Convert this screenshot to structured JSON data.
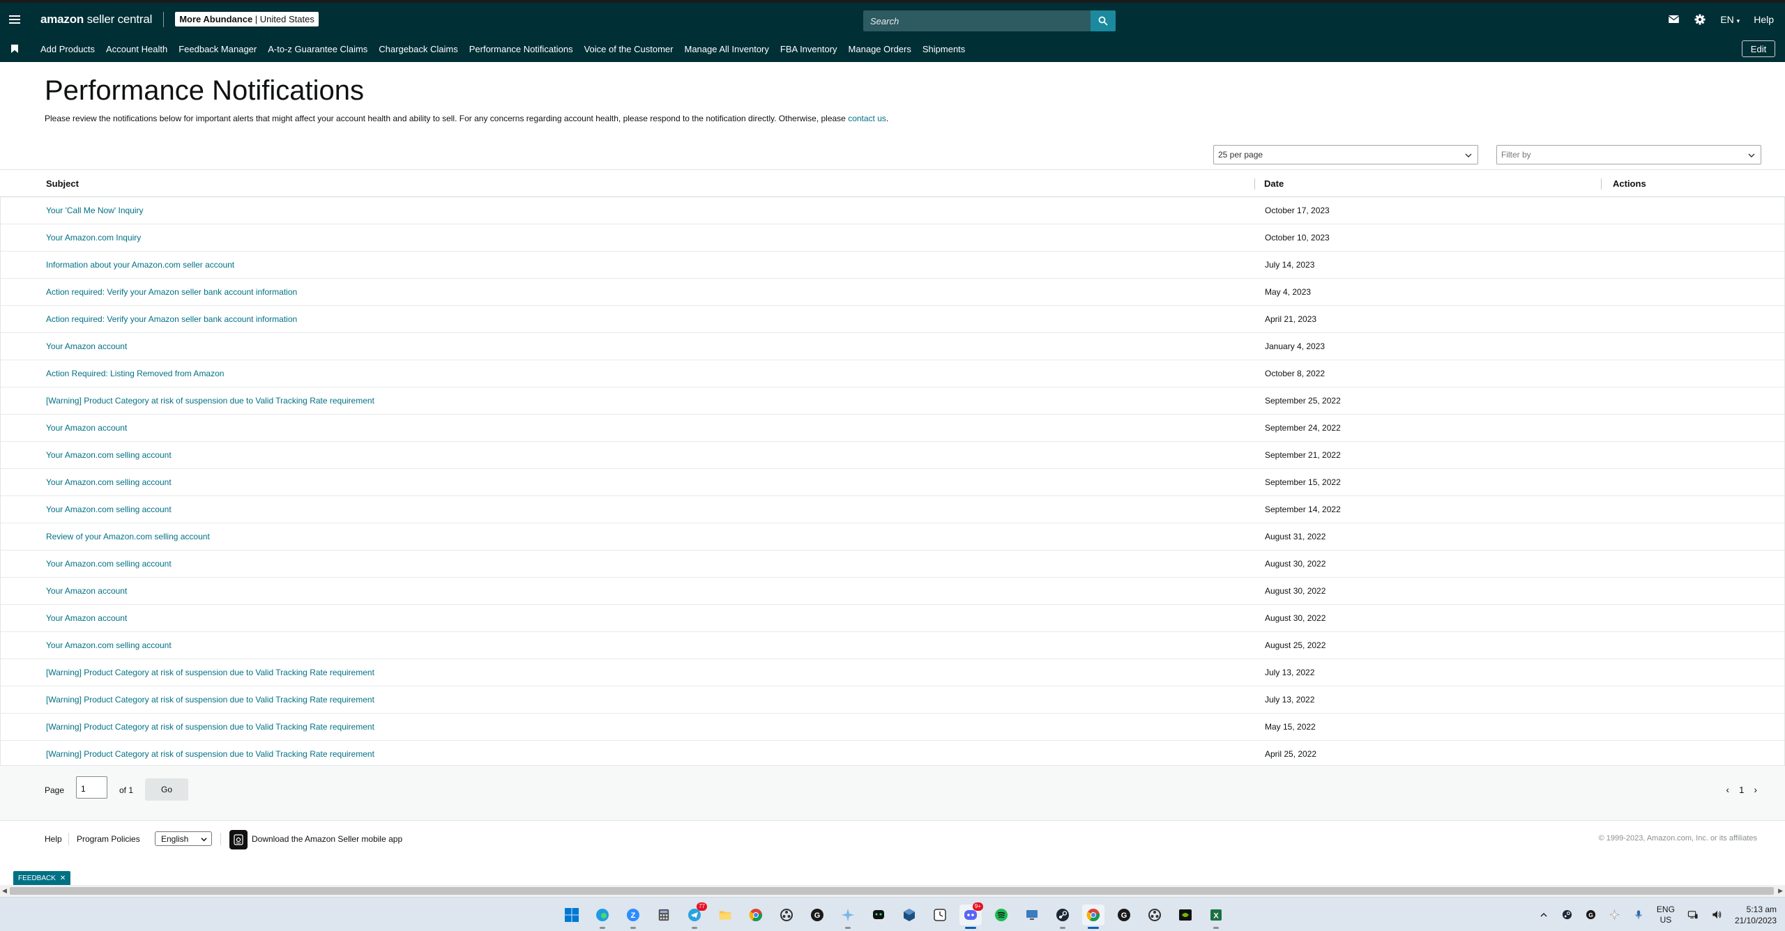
{
  "header": {
    "logo_main": "amazon",
    "logo_sub": "seller central",
    "store_name": "More Abundance",
    "store_marketplace": "United States",
    "search_placeholder": "Search",
    "language": "EN",
    "help": "Help"
  },
  "nav": {
    "items": [
      "Add Products",
      "Account Health",
      "Feedback Manager",
      "A-to-z Guarantee Claims",
      "Chargeback Claims",
      "Performance Notifications",
      "Voice of the Customer",
      "Manage All Inventory",
      "FBA Inventory",
      "Manage Orders",
      "Shipments"
    ],
    "edit_label": "Edit"
  },
  "page": {
    "title": "Performance Notifications",
    "description": "Please review the notifications below for important alerts that might affect your account health and ability to sell. For any concerns regarding account health, please respond to the notification directly. Otherwise, please ",
    "contact_link": "contact us",
    "description_end": "."
  },
  "controls": {
    "per_page": "25 per page",
    "filter_placeholder": "Filter by"
  },
  "table": {
    "headers": {
      "subject": "Subject",
      "date": "Date",
      "actions": "Actions"
    },
    "rows": [
      {
        "subject": "Your 'Call Me Now' Inquiry",
        "date": "October 17, 2023"
      },
      {
        "subject": "Your Amazon.com Inquiry",
        "date": "October 10, 2023"
      },
      {
        "subject": "Information about your Amazon.com seller account",
        "date": "July 14, 2023"
      },
      {
        "subject": "Action required: Verify your Amazon seller bank account information",
        "date": "May 4, 2023"
      },
      {
        "subject": "Action required: Verify your Amazon seller bank account information",
        "date": "April 21, 2023"
      },
      {
        "subject": "Your Amazon account",
        "date": "January 4, 2023"
      },
      {
        "subject": "Action Required: Listing Removed from Amazon",
        "date": "October 8, 2022"
      },
      {
        "subject": "[Warning] Product Category at risk of suspension due to Valid Tracking Rate requirement",
        "date": "September 25, 2022"
      },
      {
        "subject": "Your Amazon account",
        "date": "September 24, 2022"
      },
      {
        "subject": "Your Amazon.com selling account",
        "date": "September 21, 2022"
      },
      {
        "subject": "Your Amazon.com selling account",
        "date": "September 15, 2022"
      },
      {
        "subject": "Your Amazon.com selling account",
        "date": "September 14, 2022"
      },
      {
        "subject": "Review of your Amazon.com selling account",
        "date": "August 31, 2022"
      },
      {
        "subject": "Your Amazon.com selling account",
        "date": "August 30, 2022"
      },
      {
        "subject": "Your Amazon account",
        "date": "August 30, 2022"
      },
      {
        "subject": "Your Amazon account",
        "date": "August 30, 2022"
      },
      {
        "subject": "Your Amazon.com selling account",
        "date": "August 25, 2022"
      },
      {
        "subject": "[Warning] Product Category at risk of suspension due to Valid Tracking Rate requirement",
        "date": "July 13, 2022"
      },
      {
        "subject": "[Warning] Product Category at risk of suspension due to Valid Tracking Rate requirement",
        "date": "July 13, 2022"
      },
      {
        "subject": "[Warning] Product Category at risk of suspension due to Valid Tracking Rate requirement",
        "date": "May 15, 2022"
      },
      {
        "subject": "[Warning] Product Category at risk of suspension due to Valid Tracking Rate requirement",
        "date": "April 25, 2022"
      }
    ]
  },
  "pager": {
    "page_label": "Page",
    "page_value": "1",
    "of_label": "of 1",
    "go_label": "Go",
    "current_page": "1"
  },
  "footer": {
    "help": "Help",
    "program_policies": "Program Policies",
    "language": "English",
    "app_link": "Download the Amazon Seller mobile app",
    "copyright": "© 1999-2023, Amazon.com, Inc. or its affiliates",
    "feedback": "FEEDBACK"
  },
  "taskbar": {
    "telegram_badge": "77",
    "discord_badge": "9+",
    "lang_line1": "ENG",
    "lang_line2": "US",
    "time": "5:13 am",
    "date": "21/10/2023"
  },
  "colors": {
    "header_bg": "#002f36",
    "link": "#007185",
    "search_button": "#1b8a9e"
  }
}
